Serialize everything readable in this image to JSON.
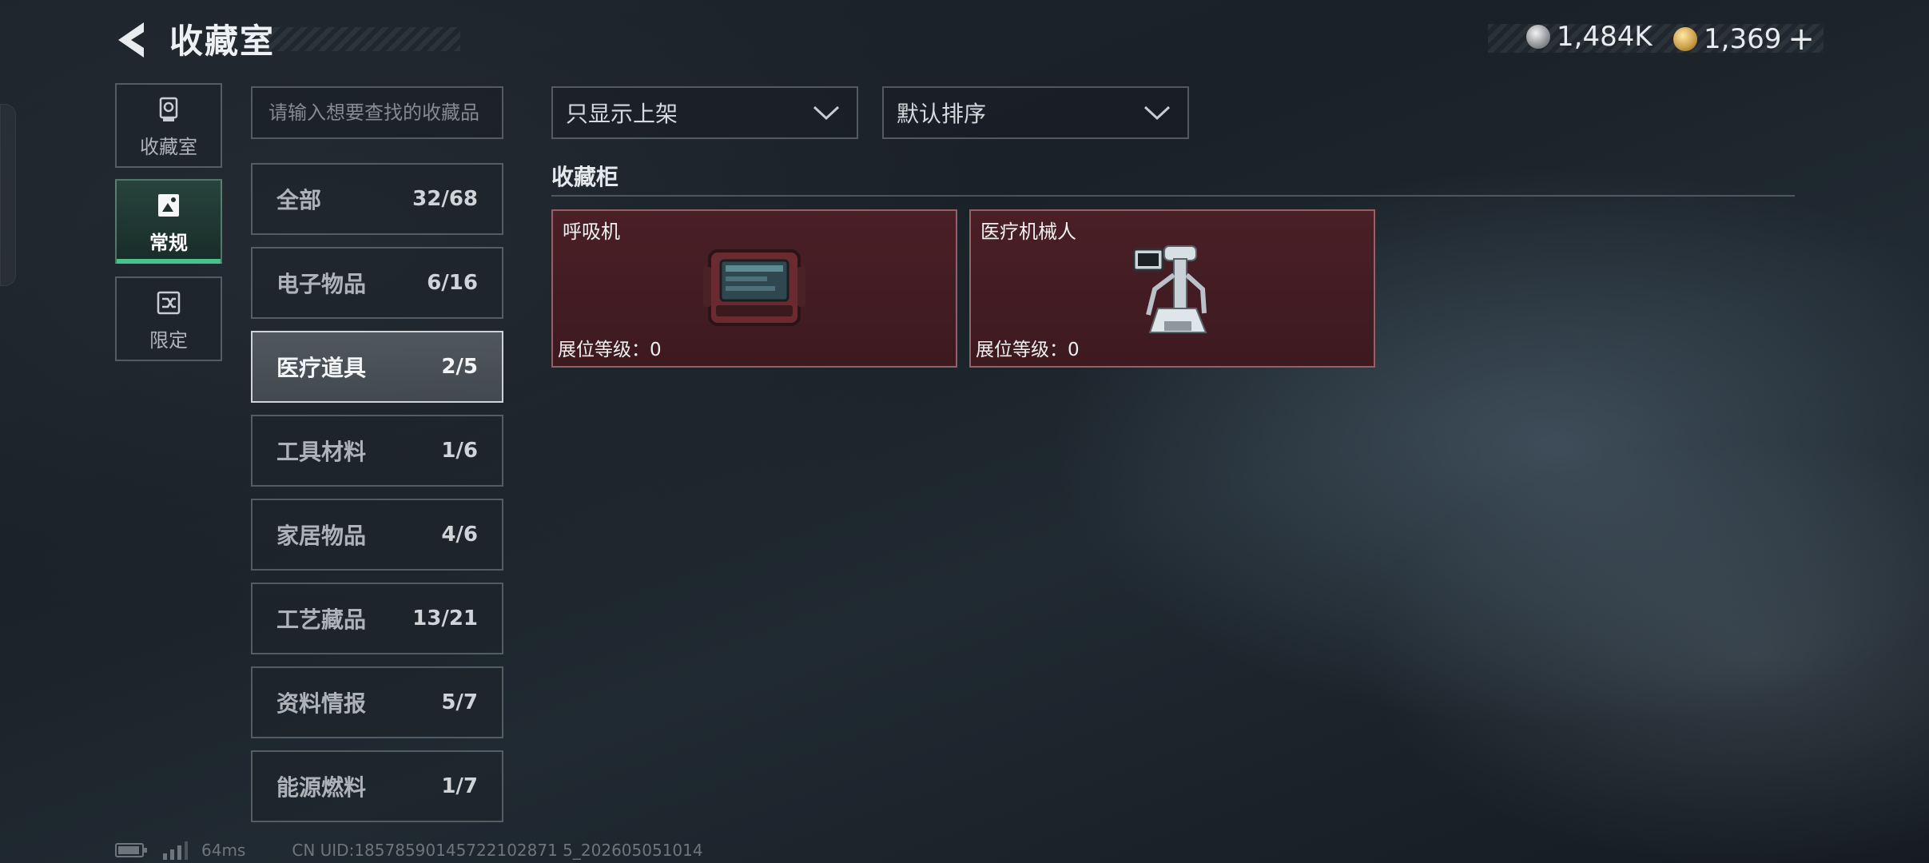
{
  "header": {
    "title": "收藏室",
    "currencies": [
      {
        "icon": "silver-coin-icon",
        "value": "1,484K"
      },
      {
        "icon": "gold-coin-icon",
        "value": "1,369"
      }
    ],
    "add_label": "+"
  },
  "side_tabs": [
    {
      "label": "收藏室",
      "icon": "trophy-icon",
      "active": false
    },
    {
      "label": "常规",
      "icon": "picture-icon",
      "active": true
    },
    {
      "label": "限定",
      "icon": "shuffle-card-icon",
      "active": false
    }
  ],
  "search": {
    "placeholder": "请输入想要查找的收藏品",
    "value": ""
  },
  "categories": [
    {
      "label": "全部",
      "count": "32/68",
      "selected": false
    },
    {
      "label": "电子物品",
      "count": "6/16",
      "selected": false
    },
    {
      "label": "医疗道具",
      "count": "2/5",
      "selected": true
    },
    {
      "label": "工具材料",
      "count": "1/6",
      "selected": false
    },
    {
      "label": "家居物品",
      "count": "4/6",
      "selected": false
    },
    {
      "label": "工艺藏品",
      "count": "13/21",
      "selected": false
    },
    {
      "label": "资料情报",
      "count": "5/7",
      "selected": false
    },
    {
      "label": "能源燃料",
      "count": "1/7",
      "selected": false
    }
  ],
  "filters": {
    "shelf_filter": "只显示上架",
    "sort": "默认排序"
  },
  "section_title": "收藏柜",
  "items": [
    {
      "name": "呼吸机",
      "level_label": "展位等级：",
      "level": "0",
      "icon": "ventilator-icon"
    },
    {
      "name": "医疗机械人",
      "level_label": "展位等级：",
      "level": "0",
      "icon": "medical-robot-icon"
    }
  ],
  "footer": {
    "ping": "64ms",
    "uid": "CN UID:18578590145722102871 5_202605051014"
  },
  "colors": {
    "accent_green": "#47c28d",
    "card_bg": "#4a1f26"
  }
}
